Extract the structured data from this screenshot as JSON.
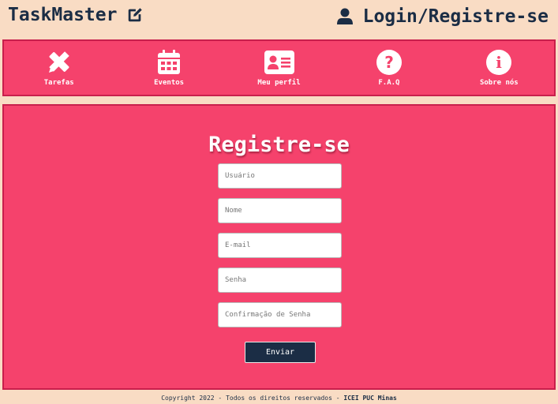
{
  "header": {
    "brand": "TaskMaster",
    "brand_icon": "edit-icon",
    "login_label": "Login/Registre-se",
    "login_icon": "user-icon"
  },
  "nav": {
    "items": [
      {
        "label": "Tarefas",
        "icon": "pencil-ruler-icon"
      },
      {
        "label": "Eventos",
        "icon": "calendar-icon"
      },
      {
        "label": "Meu perfil",
        "icon": "id-card-icon"
      },
      {
        "label": "F.A.Q",
        "icon": "question-circle-icon"
      },
      {
        "label": "Sobre nós",
        "icon": "info-circle-icon"
      }
    ]
  },
  "form": {
    "title": "Registre-se",
    "fields": {
      "usuario": {
        "placeholder": "Usuário",
        "value": ""
      },
      "nome": {
        "placeholder": "Nome",
        "value": ""
      },
      "email": {
        "placeholder": "E-mail",
        "value": ""
      },
      "senha": {
        "placeholder": "Senha",
        "value": ""
      },
      "confirmacao": {
        "placeholder": "Confirmação de Senha",
        "value": ""
      }
    },
    "submit_label": "Enviar"
  },
  "footer": {
    "text": "Copyright 2022 - Todos os direitos reservados - ",
    "org": "ICEI PUC Minas"
  },
  "colors": {
    "background": "#f9dcc4",
    "accent": "#f5426c",
    "border": "#c81f4c",
    "dark": "#1b2d45",
    "white": "#ffffff"
  }
}
